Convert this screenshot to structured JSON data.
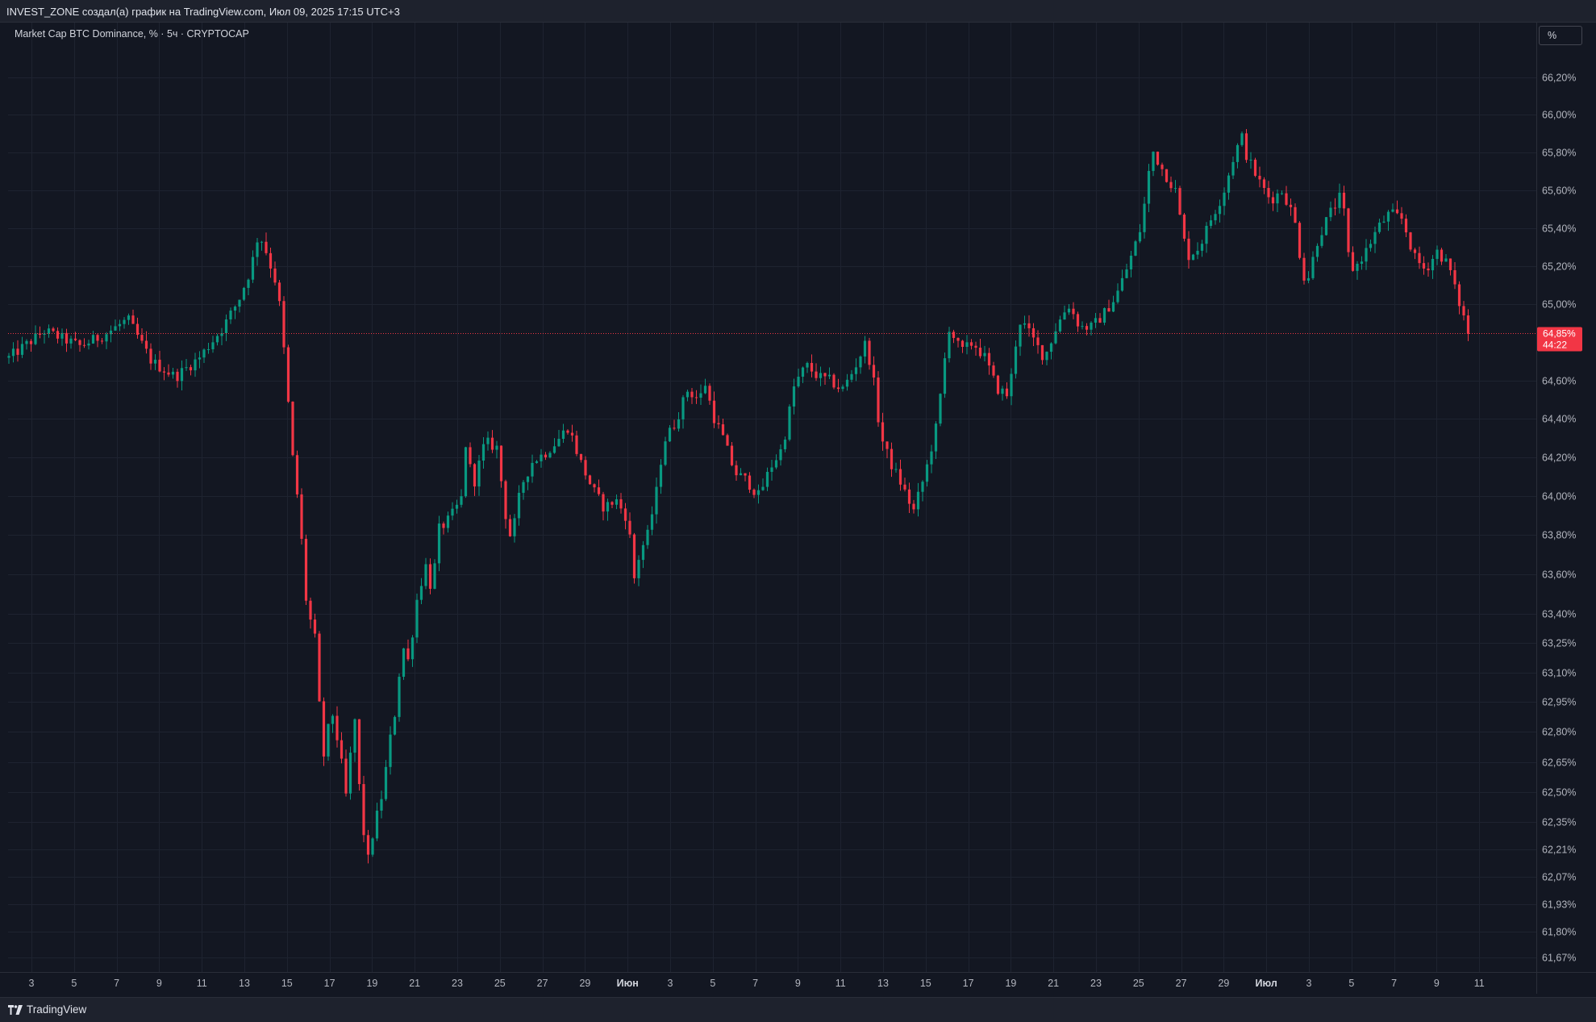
{
  "header": {
    "credit": "INVEST_ZONE создал(а) график на TradingView.com, Июл 09, 2025 17:15 UTC+3"
  },
  "legend": {
    "title": "Market Cap BTC Dominance, % · 5ч · CRYPTOCAP"
  },
  "scale_toggle": {
    "label": "%"
  },
  "footer": {
    "brand": "TradingView",
    "logo_icon": "tradingview-logo-icon"
  },
  "price_badge": {
    "value": "64,85%",
    "countdown": "44:22",
    "color": "#f23645"
  },
  "colors": {
    "up": "#089981",
    "down": "#f23645",
    "background": "#131722",
    "grid": "#1e2330",
    "last_line": "#f23645"
  },
  "chart_data": {
    "type": "candlestick",
    "title": "Market Cap BTC Dominance, % · 5ч · CRYPTOCAP",
    "interval": "5ч",
    "last_value": 64.85,
    "y_ticks": [
      "66,20%",
      "66,00%",
      "65,80%",
      "65,60%",
      "65,40%",
      "65,20%",
      "65,00%",
      "64,60%",
      "64,40%",
      "64,20%",
      "64,00%",
      "63,80%",
      "63,60%",
      "63,40%",
      "63,25%",
      "63,10%",
      "62,95%",
      "62,80%",
      "62,65%",
      "62,50%",
      "62,35%",
      "62,21%",
      "62,07%",
      "61,93%",
      "61,80%",
      "61,67%"
    ],
    "x_ticks": [
      "3",
      "5",
      "7",
      "9",
      "11",
      "13",
      "15",
      "17",
      "19",
      "21",
      "23",
      "25",
      "27",
      "29",
      "Июн",
      "3",
      "5",
      "7",
      "9",
      "11",
      "13",
      "15",
      "17",
      "19",
      "21",
      "23",
      "25",
      "27",
      "29",
      "Июл",
      "3",
      "5",
      "7",
      "9",
      "11"
    ],
    "ylim": [
      61.62,
      66.28
    ],
    "grid": true,
    "path_points": [
      [
        0,
        64.72
      ],
      [
        3,
        64.86
      ],
      [
        6,
        64.78
      ],
      [
        8,
        64.84
      ],
      [
        10,
        64.92
      ],
      [
        12,
        64.7
      ],
      [
        14,
        64.62
      ],
      [
        16,
        64.72
      ],
      [
        18,
        64.88
      ],
      [
        19.3,
        65.02
      ],
      [
        20.3,
        65.18
      ],
      [
        21,
        65.38
      ],
      [
        21.6,
        65.28
      ],
      [
        22.6,
        65.08
      ],
      [
        23.2,
        64.7
      ],
      [
        23.8,
        64.22
      ],
      [
        24.4,
        63.92
      ],
      [
        25,
        63.45
      ],
      [
        25.8,
        63.25
      ],
      [
        26.2,
        62.8
      ],
      [
        26.6,
        62.62
      ],
      [
        27,
        62.95
      ],
      [
        27.8,
        62.7
      ],
      [
        28.4,
        62.45
      ],
      [
        29,
        62.92
      ],
      [
        29.4,
        62.55
      ],
      [
        29.8,
        62.3
      ],
      [
        30.2,
        62.15
      ],
      [
        30.6,
        62.3
      ],
      [
        31.4,
        62.5
      ],
      [
        32,
        62.75
      ],
      [
        32.6,
        62.95
      ],
      [
        33,
        63.25
      ],
      [
        33.6,
        63.15
      ],
      [
        34.2,
        63.45
      ],
      [
        35,
        63.65
      ],
      [
        35.6,
        63.5
      ],
      [
        36,
        63.82
      ],
      [
        37,
        63.88
      ],
      [
        38,
        63.98
      ],
      [
        38.4,
        64.28
      ],
      [
        39,
        64.05
      ],
      [
        40,
        64.28
      ],
      [
        41,
        64.25
      ],
      [
        42,
        63.78
      ],
      [
        42.6,
        63.88
      ],
      [
        43,
        64.05
      ],
      [
        44,
        64.18
      ],
      [
        45,
        64.22
      ],
      [
        46,
        64.28
      ],
      [
        47,
        64.36
      ],
      [
        48,
        64.18
      ],
      [
        49,
        64.04
      ],
      [
        50,
        63.94
      ],
      [
        51,
        63.98
      ],
      [
        52,
        63.88
      ],
      [
        52.6,
        63.55
      ],
      [
        53,
        63.72
      ],
      [
        53.6,
        63.78
      ],
      [
        54.4,
        64.02
      ],
      [
        55,
        64.28
      ],
      [
        56,
        64.38
      ],
      [
        57,
        64.55
      ],
      [
        58,
        64.5
      ],
      [
        58.6,
        64.6
      ],
      [
        59,
        64.44
      ],
      [
        60,
        64.3
      ],
      [
        61,
        64.12
      ],
      [
        62,
        64.08
      ],
      [
        63,
        64.0
      ],
      [
        64,
        64.15
      ],
      [
        65,
        64.25
      ],
      [
        66,
        64.58
      ],
      [
        67,
        64.68
      ],
      [
        68,
        64.62
      ],
      [
        69,
        64.6
      ],
      [
        70,
        64.55
      ],
      [
        71,
        64.66
      ],
      [
        72,
        64.8
      ],
      [
        72.6,
        64.62
      ],
      [
        73.2,
        64.32
      ],
      [
        74,
        64.18
      ],
      [
        75,
        64.06
      ],
      [
        76,
        63.92
      ],
      [
        77,
        64.12
      ],
      [
        78,
        64.38
      ],
      [
        78.6,
        64.7
      ],
      [
        79,
        64.88
      ],
      [
        80,
        64.75
      ],
      [
        81,
        64.8
      ],
      [
        82,
        64.72
      ],
      [
        83,
        64.56
      ],
      [
        84,
        64.52
      ],
      [
        84.6,
        64.8
      ],
      [
        85,
        64.92
      ],
      [
        86,
        64.82
      ],
      [
        87,
        64.72
      ],
      [
        88,
        64.88
      ],
      [
        89,
        65.0
      ],
      [
        90,
        64.88
      ],
      [
        91,
        64.88
      ],
      [
        92,
        64.95
      ],
      [
        93,
        65.04
      ],
      [
        94,
        65.2
      ],
      [
        95,
        65.38
      ],
      [
        95.6,
        65.6
      ],
      [
        96,
        65.82
      ],
      [
        97,
        65.7
      ],
      [
        98,
        65.6
      ],
      [
        98.6,
        65.38
      ],
      [
        99,
        65.25
      ],
      [
        100,
        65.3
      ],
      [
        101,
        65.45
      ],
      [
        102,
        65.58
      ],
      [
        103,
        65.8
      ],
      [
        103.6,
        65.88
      ],
      [
        104,
        65.78
      ],
      [
        105,
        65.65
      ],
      [
        106,
        65.55
      ],
      [
        107,
        65.6
      ],
      [
        108,
        65.45
      ],
      [
        108.6,
        65.2
      ],
      [
        109,
        65.1
      ],
      [
        110,
        65.35
      ],
      [
        111,
        65.48
      ],
      [
        112,
        65.58
      ],
      [
        112.6,
        65.22
      ],
      [
        113,
        65.18
      ],
      [
        114,
        65.28
      ],
      [
        115,
        65.4
      ],
      [
        116,
        65.48
      ],
      [
        117,
        65.45
      ],
      [
        117.6,
        65.35
      ],
      [
        118,
        65.25
      ],
      [
        119,
        65.18
      ],
      [
        120,
        65.28
      ],
      [
        121,
        65.2
      ],
      [
        121.6,
        65.05
      ],
      [
        122,
        64.98
      ],
      [
        122.6,
        64.85
      ]
    ]
  }
}
